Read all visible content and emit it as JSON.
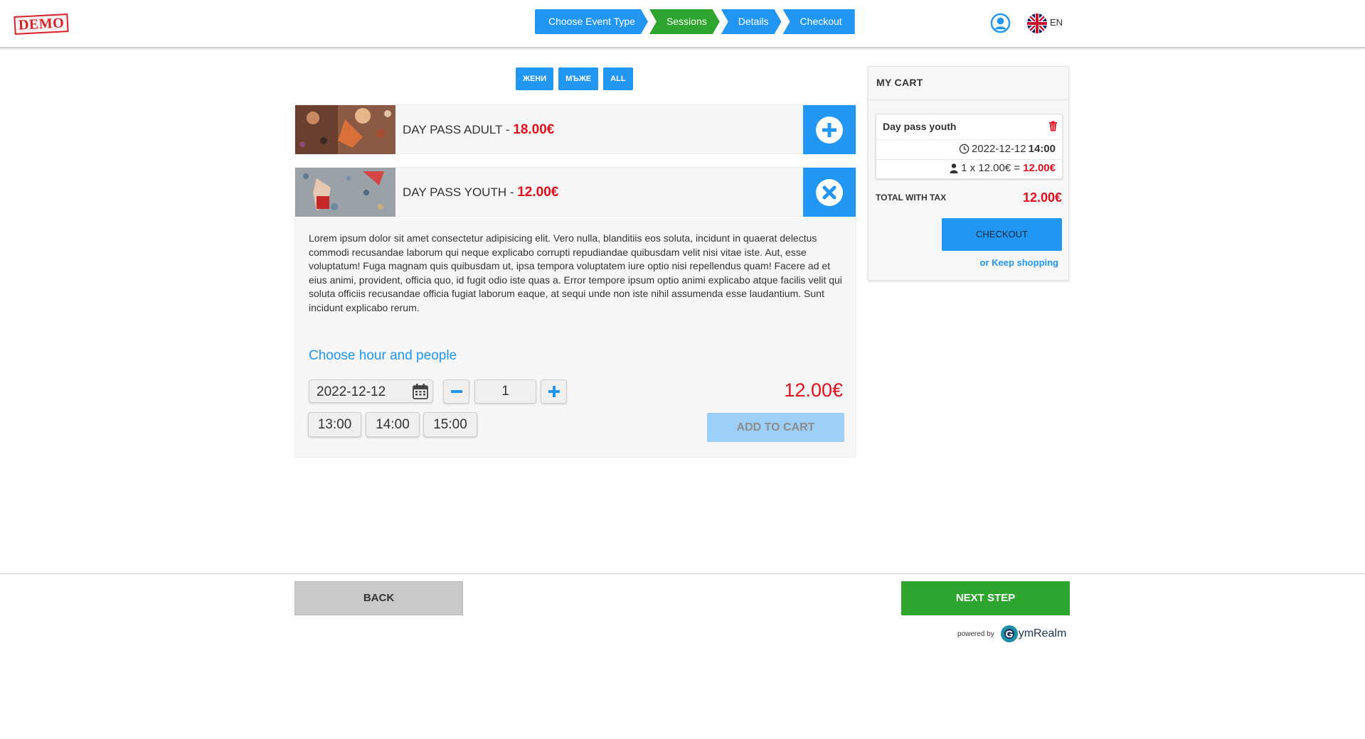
{
  "header": {
    "logo_text": "DEMO",
    "language": "EN",
    "steps": [
      "Choose Event Type",
      "Sessions",
      "Details",
      "Checkout"
    ]
  },
  "filters": [
    "ЖЕНИ",
    "МЪЖЕ",
    "ALL"
  ],
  "products": [
    {
      "name": "DAY PASS ADULT",
      "separator": " - ",
      "price": "18.00€",
      "action": "add-icon"
    },
    {
      "name": "DAY PASS YOUTH",
      "separator": " - ",
      "price": "12.00€",
      "action": "close-icon"
    }
  ],
  "details": {
    "description": "Lorem ipsum dolor sit amet consectetur adipisicing elit. Vero nulla, blanditiis eos soluta, incidunt in quaerat delectus commodi recusandae laborum qui neque explicabo corrupti repudiandae quibusdam velit nisi vitae iste. Aut, esse voluptatum! Fuga magnam quis quibusdam ut, ipsa tempora voluptatem iure optio nisi repellendus quam! Facere ad et eius animi, provident, officia quo, id fugit odio iste quas a. Error tempore ipsum optio animi explicabo atque facilis velit qui soluta officiis recusandae officia fugiat laborum eaque, at sequi unde non iste nihil assumenda esse laudantium. Sunt incidunt explicabo rerum.",
    "choose_title": "Choose hour and people",
    "date": "2022-12-12",
    "quantity": "1",
    "total": "12.00€",
    "times": [
      "13:00",
      "14:00",
      "15:00"
    ],
    "add_to_cart": "ADD TO CART"
  },
  "cart": {
    "title": "MY CART",
    "item_name": "Day pass youth",
    "item_date": "2022-12-12",
    "item_time": "14:00",
    "item_qty_text": "1 x 12.00€ =",
    "item_total": "12.00€",
    "total_label": "TOTAL WITH TAX",
    "total_value": "12.00€",
    "checkout": "CHECKOUT",
    "keep_shopping": "or Keep shopping"
  },
  "footer": {
    "back": "BACK",
    "next": "NEXT STEP",
    "powered_by": "powered by",
    "brand_g": "G",
    "brand_rest": "ymRealm"
  },
  "colors": {
    "primary_blue": "#2196f3",
    "active_green": "#2ea52e",
    "price_red": "#e0101c"
  }
}
